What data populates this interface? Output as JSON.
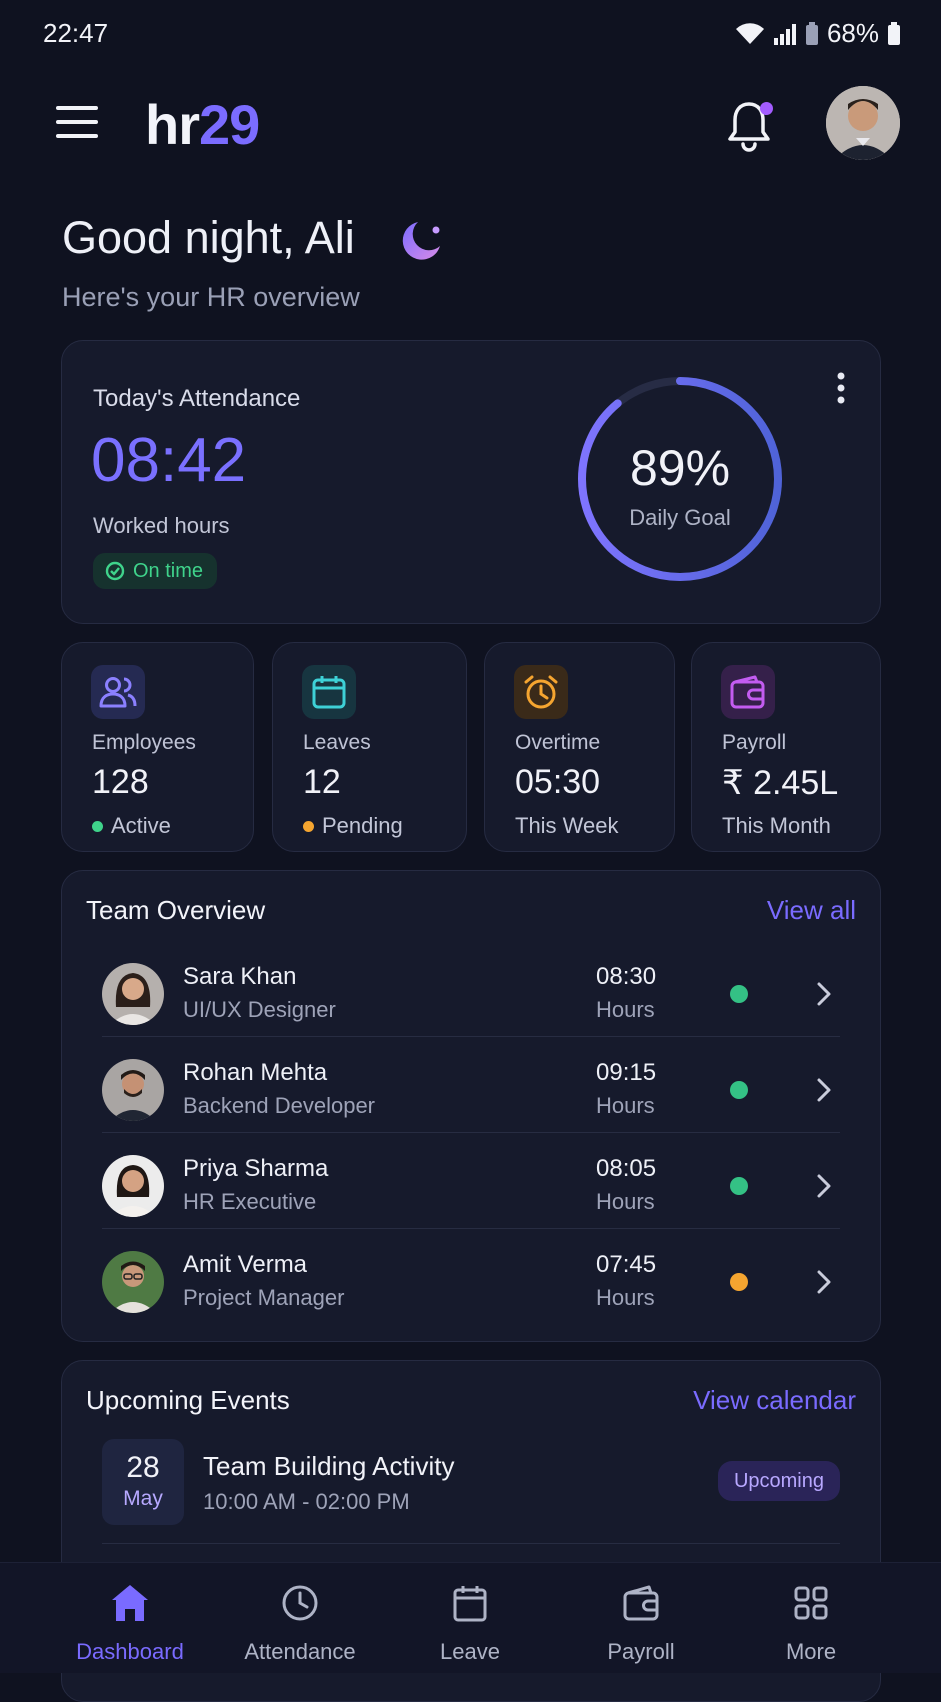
{
  "status_bar": {
    "time": "22:47",
    "battery": "68%"
  },
  "header": {
    "logo_main": "hr",
    "logo_accent": "29"
  },
  "greeting": {
    "title": "Good night, Ali",
    "subtitle": "Here's your HR overview"
  },
  "attendance": {
    "label": "Today's Attendance",
    "hours": "08:42",
    "hours_label": "Worked hours",
    "status": "On time",
    "goal_percent": "89%",
    "goal_value": 0.89,
    "goal_label": "Daily Goal"
  },
  "stats": [
    {
      "title": "Employees",
      "value": "128",
      "sub": "Active",
      "icon": "users-icon",
      "dot_color": "#3fd38b"
    },
    {
      "title": "Leaves",
      "value": "12",
      "sub": "Pending",
      "icon": "calendar-icon",
      "dot_color": "#f5a530"
    },
    {
      "title": "Overtime",
      "value": "05:30",
      "sub": "This Week",
      "icon": "alarm-clock-icon"
    },
    {
      "title": "Payroll",
      "value": "₹ 2.45L",
      "sub": "This Month",
      "icon": "wallet-icon"
    }
  ],
  "team": {
    "title": "Team Overview",
    "link": "View all",
    "members": [
      {
        "name": "Sara Khan",
        "role": "UI/UX Designer",
        "time": "08:30",
        "unit": "Hours",
        "status_color": "#34c185"
      },
      {
        "name": "Rohan Mehta",
        "role": "Backend Developer",
        "time": "09:15",
        "unit": "Hours",
        "status_color": "#34c185"
      },
      {
        "name": "Priya Sharma",
        "role": "HR Executive",
        "time": "08:05",
        "unit": "Hours",
        "status_color": "#34c185"
      },
      {
        "name": "Amit Verma",
        "role": "Project Manager",
        "time": "07:45",
        "unit": "Hours",
        "status_color": "#f5a530"
      }
    ]
  },
  "events": {
    "title": "Upcoming Events",
    "link": "View calendar",
    "items": [
      {
        "day": "28",
        "month": "May",
        "name": "Team Building Activity",
        "time": "10:00 AM - 02:00 PM",
        "badge": "Upcoming"
      }
    ]
  },
  "nav": [
    {
      "label": "Dashboard",
      "icon": "home-icon",
      "active": true
    },
    {
      "label": "Attendance",
      "icon": "clock-icon"
    },
    {
      "label": "Leave",
      "icon": "calendar-icon"
    },
    {
      "label": "Payroll",
      "icon": "wallet-icon"
    },
    {
      "label": "More",
      "icon": "grid-icon"
    }
  ],
  "colors": {
    "accent": "#7a6bff",
    "background": "#0f1220",
    "card": "#161a2c",
    "success": "#3fd38b",
    "warning": "#f5a530"
  }
}
